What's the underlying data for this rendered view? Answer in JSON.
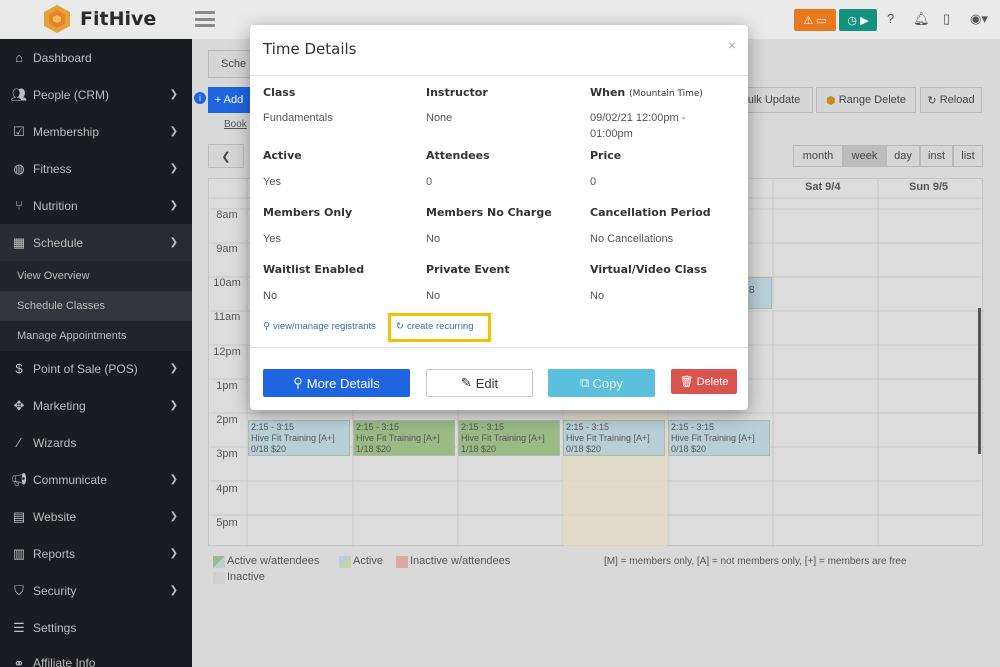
{
  "app": {
    "name": "FitHive"
  },
  "sidebar": {
    "items": [
      {
        "label": "Dashboard",
        "icon": "home-icon"
      },
      {
        "label": "People (CRM)",
        "icon": "users-icon"
      },
      {
        "label": "Membership",
        "icon": "check-square-icon"
      },
      {
        "label": "Fitness",
        "icon": "dumbbell-icon"
      },
      {
        "label": "Nutrition",
        "icon": "utensils-icon"
      },
      {
        "label": "Schedule",
        "icon": "calendar-icon"
      },
      {
        "label": "Point of Sale (POS)",
        "icon": "dollar-icon"
      },
      {
        "label": "Marketing",
        "icon": "arrows-icon"
      },
      {
        "label": "Wizards",
        "icon": "wand-icon"
      },
      {
        "label": "Communicate",
        "icon": "bullhorn-icon"
      },
      {
        "label": "Website",
        "icon": "page-icon"
      },
      {
        "label": "Reports",
        "icon": "bar-chart-icon"
      },
      {
        "label": "Security",
        "icon": "shield-icon"
      },
      {
        "label": "Settings",
        "icon": "sliders-icon"
      },
      {
        "label": "Affiliate Info",
        "icon": "link-icon"
      }
    ],
    "schedule_sub": [
      "View Overview",
      "Schedule Classes",
      "Manage Appointments"
    ]
  },
  "background": {
    "tab_label": "Sche",
    "add_label": "+ Add",
    "book_label": "Book",
    "bulk_update": "ulk Update",
    "range_delete": "Range Delete",
    "reload": "Reload",
    "views": [
      "month",
      "week",
      "day",
      "inst",
      "list"
    ],
    "days": [
      "Sat 9/4",
      "Sun 9/5"
    ],
    "hours": [
      "8am",
      "9am",
      "10am",
      "11am",
      "12pm",
      "1pm",
      "2pm",
      "3pm",
      "4pm",
      "5pm"
    ],
    "events": [
      {
        "time": "2:15 - 3:15",
        "title": "Hive Fit Training [A+]",
        "count": "0/18 $20"
      },
      {
        "time": "2:15 - 3:15",
        "title": "Hive Fit Training [A+]",
        "count": "1/18 $20"
      },
      {
        "time": "2:15 - 3:15",
        "title": "Hive Fit Training [A+]",
        "count": "1/18 $20"
      },
      {
        "time": "2:15 - 3:15",
        "title": "Hive Fit Training [A+]",
        "count": "0/18 $20"
      },
      {
        "time": "2:15 - 3:15",
        "title": "Hive Fit Training [A+]",
        "count": "0/18 $20"
      }
    ],
    "legend": [
      "Active w/attendees",
      "Active",
      "Inactive w/attendees",
      "Inactive"
    ],
    "legend_note": "[M] = members only, [A] = not members only, [+] = members are free",
    "partial_event_text": "8"
  },
  "modal": {
    "title": "Time Details",
    "close": "×",
    "fields": [
      {
        "label": "Class",
        "value": "Fundamentals"
      },
      {
        "label": "Instructor",
        "value": "None"
      },
      {
        "label": "When",
        "label_note": "(Mountain Time)",
        "value": "09/02/21 12:00pm - 01:00pm"
      },
      {
        "label": "Active",
        "value": "Yes"
      },
      {
        "label": "Attendees",
        "value": "0"
      },
      {
        "label": "Price",
        "value": "0"
      },
      {
        "label": "Members Only",
        "value": "Yes"
      },
      {
        "label": "Members No Charge",
        "value": "No"
      },
      {
        "label": "Cancellation Period",
        "value": "No Cancellations"
      },
      {
        "label": "Waitlist Enabled",
        "value": "No"
      },
      {
        "label": "Private Event",
        "value": "No"
      },
      {
        "label": "Virtual/Video Class",
        "value": "No"
      }
    ],
    "links": {
      "registrants": "view/manage registrants",
      "recurring": "create recurring"
    },
    "buttons": {
      "more_details": "More Details",
      "edit": "Edit",
      "copy": "Copy",
      "delete": "Delete"
    }
  },
  "colors": {
    "primary": "#1f65e0",
    "info": "#5bc0de",
    "danger": "#d9534f",
    "highlight": "#f2c200",
    "warning": "#e8791e",
    "success": "#15927f"
  }
}
